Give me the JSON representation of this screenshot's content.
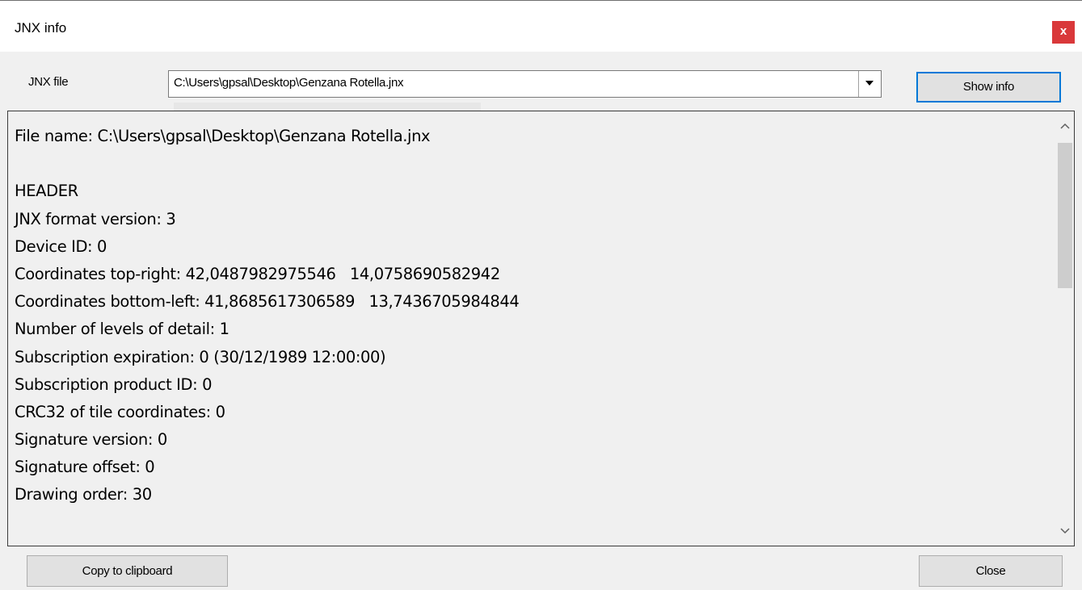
{
  "window": {
    "title": "JNX info",
    "close_glyph": "x",
    "close_color": "#d9383a"
  },
  "file_row": {
    "label": "JNX file",
    "path_value": "C:\\Users\\gpsal\\Desktop\\Genzana Rotella.jnx",
    "dropdown_icon": "triangle-down-icon",
    "show_info_label": "Show info",
    "focus_color": "#0078d7"
  },
  "info_text": {
    "lines": [
      "File name: C:\\Users\\gpsal\\Desktop\\Genzana Rotella.jnx",
      "",
      "HEADER",
      "JNX format version: 3",
      "Device ID: 0",
      "Coordinates top-right: 42,0487982975546   14,0758690582942",
      "Coordinates bottom-left: 41,8685617306589   13,7436705984844",
      "Number of levels of detail: 1",
      "Subscription expiration: 0 (30/12/1989 12:00:00)",
      "Subscription product ID: 0",
      "CRC32 of tile coordinates: 0",
      "Signature version: 0",
      "Signature offset: 0",
      "Drawing order: 30"
    ]
  },
  "footer": {
    "copy_label": "Copy to clipboard",
    "close_label": "Close"
  }
}
